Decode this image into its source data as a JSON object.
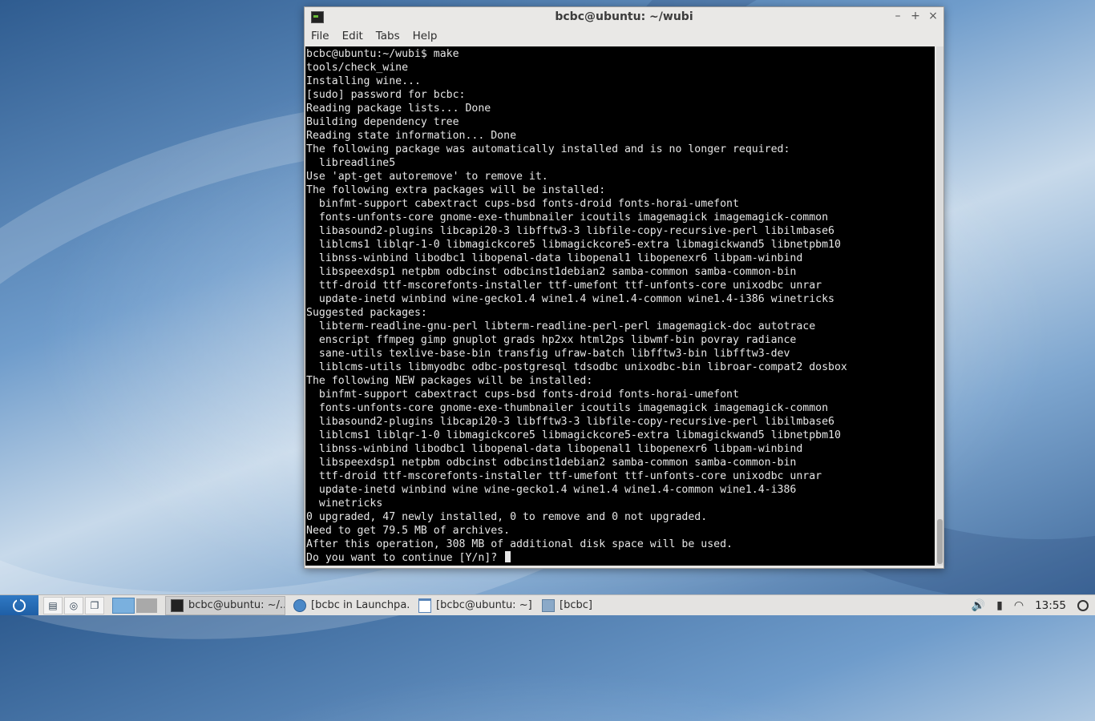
{
  "window": {
    "title": "bcbc@ubuntu: ~/wubi",
    "controls": {
      "minimize": "–",
      "maximize": "+",
      "close": "×"
    }
  },
  "menubar": {
    "items": [
      "File",
      "Edit",
      "Tabs",
      "Help"
    ]
  },
  "terminal": {
    "lines": [
      "bcbc@ubuntu:~/wubi$ make",
      "tools/check_wine",
      "Installing wine...",
      "[sudo] password for bcbc:",
      "Reading package lists... Done",
      "Building dependency tree",
      "Reading state information... Done",
      "The following package was automatically installed and is no longer required:",
      "  libreadline5",
      "Use 'apt-get autoremove' to remove it.",
      "The following extra packages will be installed:",
      "  binfmt-support cabextract cups-bsd fonts-droid fonts-horai-umefont",
      "  fonts-unfonts-core gnome-exe-thumbnailer icoutils imagemagick imagemagick-common",
      "  libasound2-plugins libcapi20-3 libfftw3-3 libfile-copy-recursive-perl libilmbase6",
      "  liblcms1 liblqr-1-0 libmagickcore5 libmagickcore5-extra libmagickwand5 libnetpbm10",
      "  libnss-winbind libodbc1 libopenal-data libopenal1 libopenexr6 libpam-winbind",
      "  libspeexdsp1 netpbm odbcinst odbcinst1debian2 samba-common samba-common-bin",
      "  ttf-droid ttf-mscorefonts-installer ttf-umefont ttf-unfonts-core unixodbc unrar",
      "  update-inetd winbind wine-gecko1.4 wine1.4 wine1.4-common wine1.4-i386 winetricks",
      "Suggested packages:",
      "  libterm-readline-gnu-perl libterm-readline-perl-perl imagemagick-doc autotrace",
      "  enscript ffmpeg gimp gnuplot grads hp2xx html2ps libwmf-bin povray radiance",
      "  sane-utils texlive-base-bin transfig ufraw-batch libfftw3-bin libfftw3-dev",
      "  liblcms-utils libmyodbc odbc-postgresql tdsodbc unixodbc-bin libroar-compat2 dosbox",
      "The following NEW packages will be installed:",
      "  binfmt-support cabextract cups-bsd fonts-droid fonts-horai-umefont",
      "  fonts-unfonts-core gnome-exe-thumbnailer icoutils imagemagick imagemagick-common",
      "  libasound2-plugins libcapi20-3 libfftw3-3 libfile-copy-recursive-perl libilmbase6",
      "  liblcms1 liblqr-1-0 libmagickcore5 libmagickcore5-extra libmagickwand5 libnetpbm10",
      "  libnss-winbind libodbc1 libopenal-data libopenal1 libopenexr6 libpam-winbind",
      "  libspeexdsp1 netpbm odbcinst odbcinst1debian2 samba-common samba-common-bin",
      "  ttf-droid ttf-mscorefonts-installer ttf-umefont ttf-unfonts-core unixodbc unrar",
      "  update-inetd winbind wine wine-gecko1.4 wine1.4 wine1.4-common wine1.4-i386",
      "  winetricks",
      "0 upgraded, 47 newly installed, 0 to remove and 0 not upgraded.",
      "Need to get 79.5 MB of archives.",
      "After this operation, 308 MB of additional disk space will be used."
    ],
    "prompt": "Do you want to continue [Y/n]? "
  },
  "taskbar": {
    "tasks": [
      {
        "label": "bcbc@ubuntu: ~/...",
        "icon": "terminal-icon",
        "active": true
      },
      {
        "label": "[bcbc in Launchpa...",
        "icon": "browser-icon",
        "active": false
      },
      {
        "label": "[bcbc@ubuntu: ~]",
        "icon": "window-icon",
        "active": false
      },
      {
        "label": "[bcbc]",
        "icon": "folder-icon",
        "active": false
      }
    ],
    "clock": "13:55"
  },
  "colors": {
    "terminal_bg": "#000000",
    "terminal_fg": "#e6e6e6",
    "start_button": "#2f79c4"
  }
}
